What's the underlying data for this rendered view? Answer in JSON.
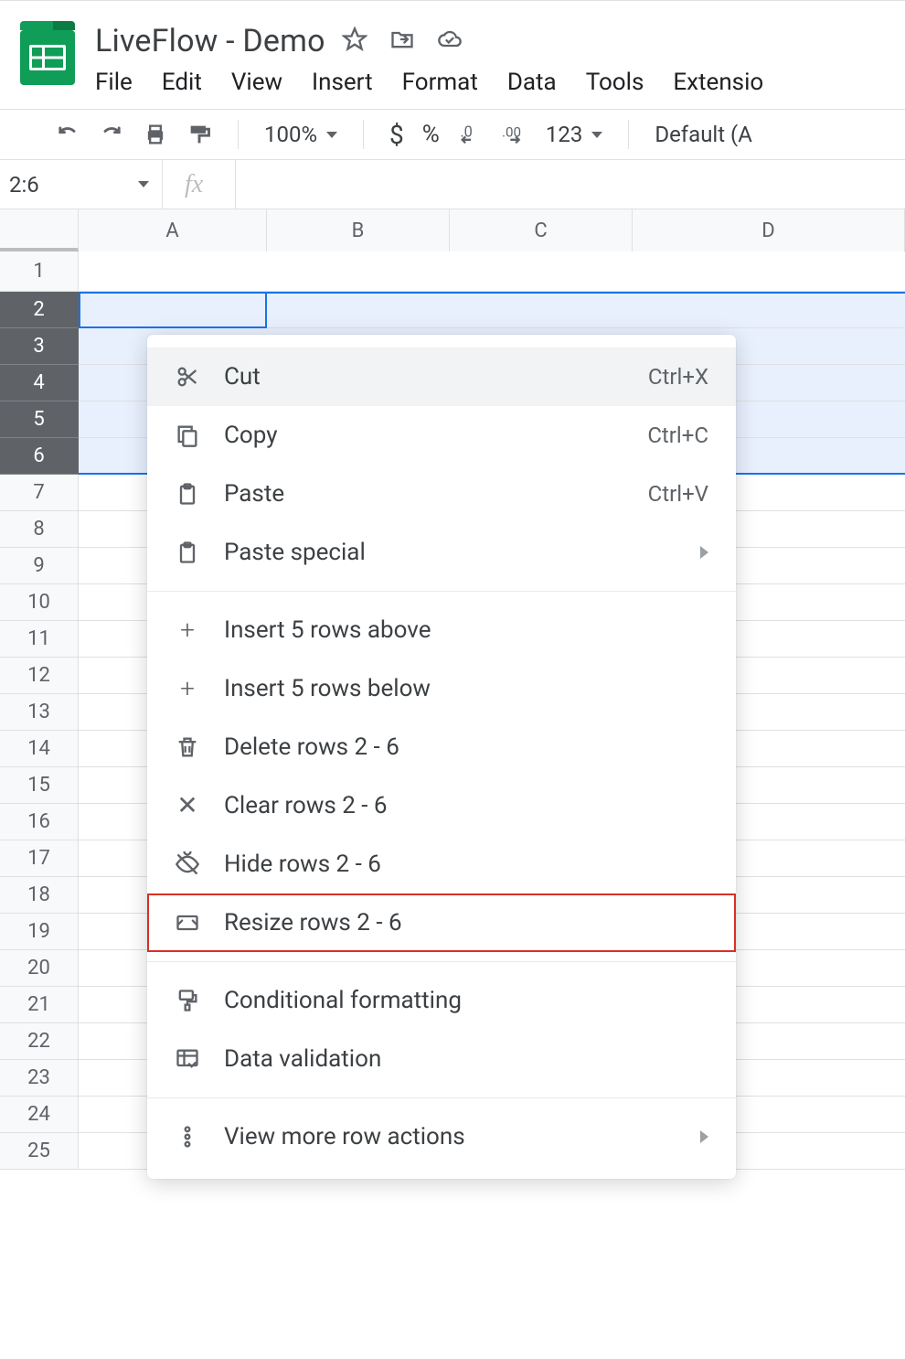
{
  "doc": {
    "title": "LiveFlow - Demo"
  },
  "menubar": [
    "File",
    "Edit",
    "View",
    "Insert",
    "Format",
    "Data",
    "Tools",
    "Extensio"
  ],
  "toolbar": {
    "zoom": "100%",
    "num_format": "123",
    "font": "Default (A"
  },
  "namebox": "2:6",
  "grid": {
    "columns": [
      "A",
      "B",
      "C",
      "D"
    ],
    "rows_visible": 25,
    "selected_rows": [
      2,
      3,
      4,
      5,
      6
    ]
  },
  "context_menu": {
    "items": [
      {
        "icon": "scissors-icon",
        "label": "Cut",
        "accel": "Ctrl+X",
        "hover": true
      },
      {
        "icon": "copy-icon",
        "label": "Copy",
        "accel": "Ctrl+C"
      },
      {
        "icon": "paste-icon",
        "label": "Paste",
        "accel": "Ctrl+V"
      },
      {
        "icon": "paste-icon",
        "label": "Paste special",
        "submenu": true
      },
      {
        "sep": true
      },
      {
        "icon": "plus-icon",
        "label": "Insert 5 rows above"
      },
      {
        "icon": "plus-icon",
        "label": "Insert 5 rows below"
      },
      {
        "icon": "trash-icon",
        "label": "Delete rows 2 - 6"
      },
      {
        "icon": "close-icon",
        "label": "Clear rows 2 - 6"
      },
      {
        "icon": "eye-off-icon",
        "label": "Hide rows 2 - 6"
      },
      {
        "icon": "resize-icon",
        "label": "Resize rows 2 - 6",
        "highlighted": true
      },
      {
        "sep": true
      },
      {
        "icon": "paint-icon",
        "label": "Conditional formatting"
      },
      {
        "icon": "validation-icon",
        "label": "Data validation"
      },
      {
        "sep": true
      },
      {
        "icon": "more-icon",
        "label": "View more row actions",
        "submenu": true
      }
    ]
  }
}
